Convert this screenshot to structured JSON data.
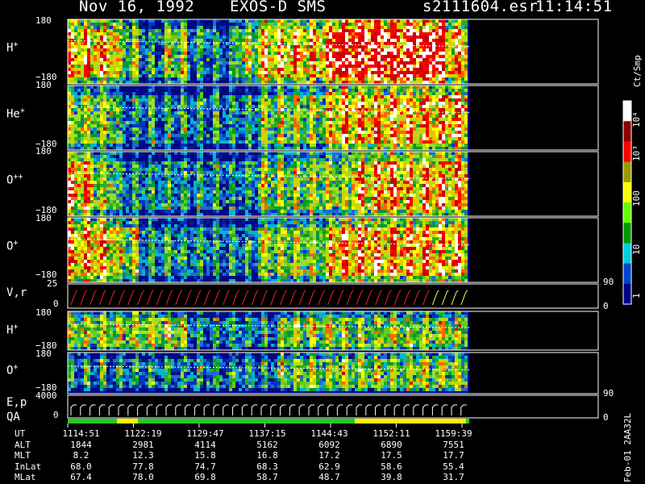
{
  "header": {
    "date": "Nov 16, 1992",
    "instrument": "EXOS-D SMS",
    "file": "s2111604.esr",
    "time": "11:14:51"
  },
  "panels": [
    {
      "id": "h-plus-top",
      "species": "H",
      "charge": "+",
      "ymax": "180",
      "ymin": "−180"
    },
    {
      "id": "he-plus",
      "species": "He",
      "charge": "+",
      "ymax": "180",
      "ymin": "−180"
    },
    {
      "id": "o-plus-plus",
      "species": "O",
      "charge": "++",
      "ymax": "180",
      "ymin": "−180"
    },
    {
      "id": "o-plus-top",
      "species": "O",
      "charge": "+",
      "ymax": "180",
      "ymin": "−180"
    },
    {
      "id": "h-plus-bottom",
      "species": "H",
      "charge": "+",
      "ymax": "180",
      "ymin": "−180"
    },
    {
      "id": "o-plus-bottom",
      "species": "O",
      "charge": "+",
      "ymax": "180",
      "ymin": "−180"
    }
  ],
  "vr_panel": {
    "label": "V,r",
    "left_max": "25",
    "left_min": "0",
    "right_max": "90",
    "right_min": "0"
  },
  "ep_panel": {
    "label1": "E,p",
    "label2": "QA",
    "left_max": "4000",
    "left_min": "0",
    "right_max": "90",
    "right_min": "0"
  },
  "colorbar": {
    "unit": "Ct/Smp",
    "ticks": [
      {
        "label": "10⁴",
        "value": 10000
      },
      {
        "label": "10³",
        "value": 1000
      },
      {
        "label": "100",
        "value": 100
      },
      {
        "label": "10",
        "value": 10
      },
      {
        "label": "1",
        "value": 1
      }
    ],
    "colors": [
      "#ffffff",
      "#8b0000",
      "#ff0000",
      "#9a9a00",
      "#ffff00",
      "#66ff00",
      "#009900",
      "#00ccdd",
      "#0044cc",
      "#000088"
    ]
  },
  "footer_note": "Feb-01 2AA32L",
  "ephemeris": {
    "rows": [
      {
        "label": "UT",
        "values": [
          "1114:51",
          "1122:19",
          "1129:47",
          "1137:15",
          "1144:43",
          "1152:11",
          "1159:39"
        ]
      },
      {
        "label": "ALT",
        "values": [
          "1844",
          "2981",
          "4114",
          "5162",
          "6092",
          "6890",
          "7551"
        ]
      },
      {
        "label": "MLT",
        "values": [
          "8.2",
          "12.3",
          "15.8",
          "16.8",
          "17.2",
          "17.5",
          "17.7"
        ]
      },
      {
        "label": "InLat",
        "values": [
          "68.0",
          "77.8",
          "74.7",
          "68.3",
          "62.9",
          "58.6",
          "55.4"
        ]
      },
      {
        "label": "MLat",
        "values": [
          "67.4",
          "78.0",
          "69.8",
          "58.7",
          "48.7",
          "39.8",
          "31.7"
        ]
      }
    ]
  },
  "chart_data": {
    "type": "heatmap",
    "title": "Nov 16, 1992   EXOS-D SMS",
    "x_ticks": [
      "1114:51",
      "1122:19",
      "1129:47",
      "1137:15",
      "1144:43",
      "1152:11",
      "1159:39"
    ],
    "y_range": [
      -180,
      180
    ],
    "color_scale": "log",
    "color_range": [
      1,
      10000
    ],
    "color_unit": "Ct/Smp",
    "series": [
      {
        "name": "H+",
        "intensity_profile": [
          3,
          3,
          2,
          1,
          2,
          1,
          1,
          2,
          3,
          3,
          3,
          4,
          4,
          4,
          4,
          4,
          3
        ]
      },
      {
        "name": "He+",
        "intensity_profile": [
          2,
          2,
          1,
          1,
          1,
          1,
          1,
          1,
          2,
          2,
          2,
          3,
          3,
          3,
          3,
          3,
          3
        ]
      },
      {
        "name": "O++",
        "intensity_profile": [
          3,
          2,
          1,
          1,
          1,
          1,
          1,
          1,
          2,
          2,
          2,
          2,
          3,
          3,
          3,
          3,
          3
        ]
      },
      {
        "name": "O+",
        "intensity_profile": [
          3,
          3,
          2,
          1,
          1,
          1,
          1,
          1,
          2,
          2,
          2,
          3,
          3,
          3,
          3,
          3,
          3
        ]
      },
      {
        "name": "H+",
        "intensity_profile": [
          2,
          2,
          2,
          2,
          2,
          1,
          1,
          1,
          1,
          2,
          2,
          2,
          2,
          2,
          2,
          2,
          2
        ]
      },
      {
        "name": "O+",
        "intensity_profile": [
          1,
          1,
          1,
          1,
          1,
          1,
          1,
          1,
          1,
          2,
          2,
          2,
          2,
          2,
          2,
          2,
          2
        ]
      }
    ]
  }
}
